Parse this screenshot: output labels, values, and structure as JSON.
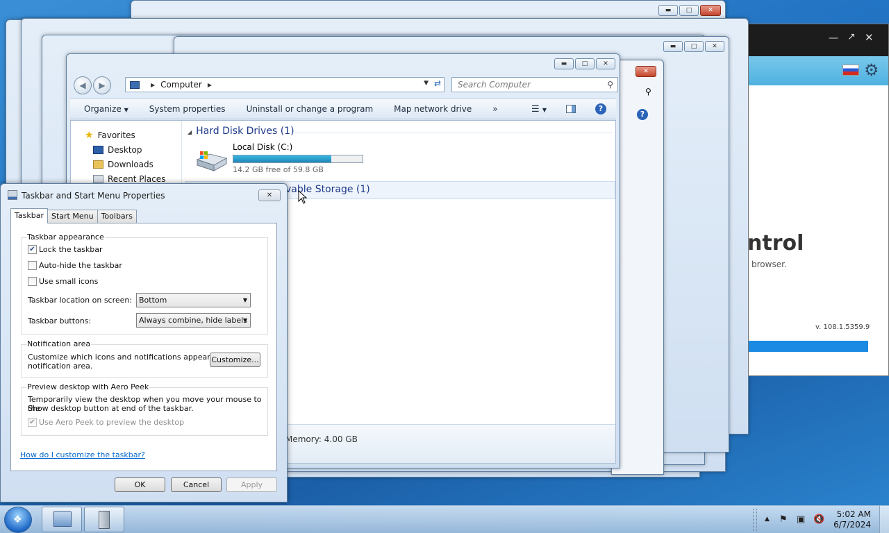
{
  "explorer": {
    "address_location": "Computer",
    "search_placeholder": "Search Computer",
    "toolbar": {
      "organize": "Organize",
      "system_properties": "System properties",
      "uninstall": "Uninstall or change a program",
      "map_network": "Map network drive",
      "more": "»"
    },
    "nav_items": [
      "Favorites",
      "Desktop",
      "Downloads",
      "Recent Places"
    ],
    "groups": {
      "hdd": "Hard Disk Drives (1)",
      "removable": "vable Storage (1)"
    },
    "drive": {
      "name": "Local Disk (C:)",
      "free_text": "14.2 GB free of 59.8 GB",
      "used_fraction": 0.76
    },
    "details_memory": "Memory: 4.00 GB"
  },
  "app_window": {
    "title_partial": "ntrol",
    "sub_partial": "browser.",
    "version": "v. 108.1.5359.9"
  },
  "dialog": {
    "title": "Taskbar and Start Menu Properties",
    "tabs": [
      "Taskbar",
      "Start Menu",
      "Toolbars"
    ],
    "appearance": {
      "title": "Taskbar appearance",
      "lock": "Lock the taskbar",
      "lock_checked": true,
      "autohide": "Auto-hide the taskbar",
      "autohide_checked": false,
      "small_icons": "Use small icons",
      "small_icons_checked": false,
      "location_label": "Taskbar location on screen:",
      "location_value": "Bottom",
      "buttons_label": "Taskbar buttons:",
      "buttons_value": "Always combine, hide labels"
    },
    "notification": {
      "title": "Notification area",
      "text_line1": "Customize which icons and notifications appear in the",
      "text_line2": "notification area.",
      "customize_button": "Customize..."
    },
    "aero": {
      "title": "Preview desktop with Aero Peek",
      "text_line1": "Temporarily view the desktop when you move your mouse to the",
      "text_line2": "Show desktop button at end of the taskbar.",
      "use_peek": "Use Aero Peek to preview the desktop",
      "use_peek_checked": true
    },
    "help_link": "How do I customize the taskbar?",
    "ok": "OK",
    "cancel": "Cancel",
    "apply": "Apply"
  },
  "taskbar": {
    "time": "5:02 AM",
    "date": "6/7/2024"
  },
  "colors": {
    "accent_blue": "#1e3a8a",
    "drive_fill": "#2a9ccd",
    "close_red": "#c4462d"
  }
}
